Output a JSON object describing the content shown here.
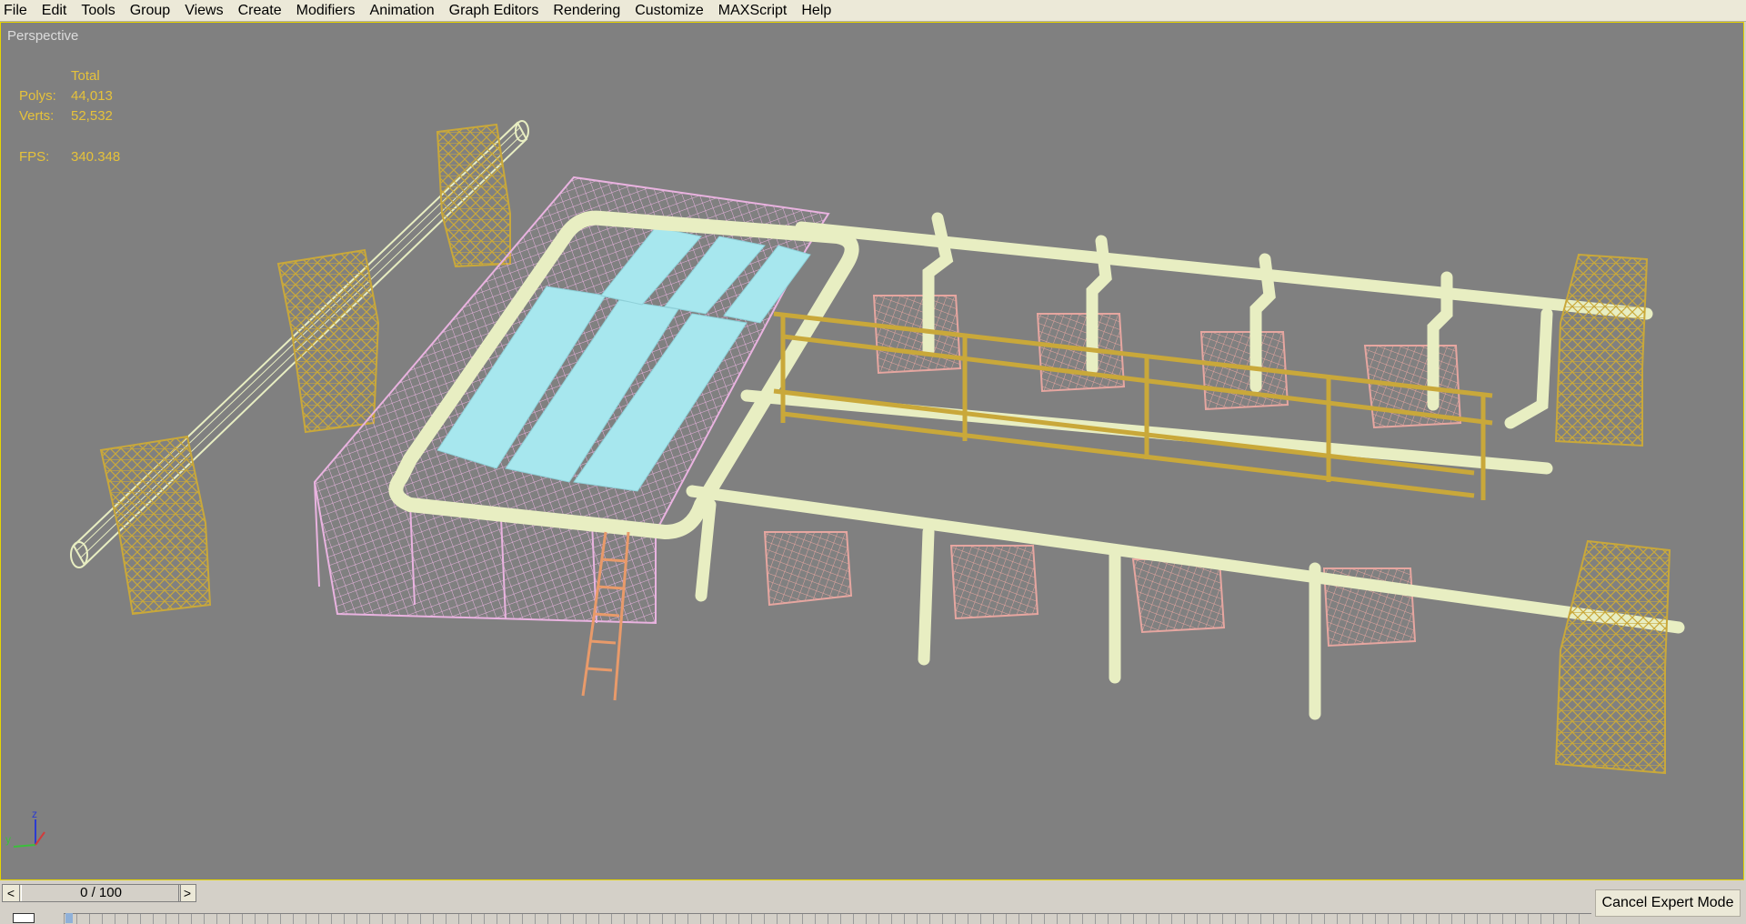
{
  "menu": [
    "File",
    "Edit",
    "Tools",
    "Group",
    "Views",
    "Create",
    "Modifiers",
    "Animation",
    "Graph Editors",
    "Rendering",
    "Customize",
    "MAXScript",
    "Help"
  ],
  "viewport": {
    "label": "Perspective",
    "stats": {
      "header": "Total",
      "polys_label": "Polys:",
      "polys_value": "44,013",
      "verts_label": "Verts:",
      "verts_value": "52,532",
      "fps_label": "FPS:",
      "fps_value": "340.348"
    },
    "axis": {
      "z": "z",
      "y": "y"
    },
    "scene_colors": {
      "background": "#808080",
      "steel_yellow": "#c9a83a",
      "pipe_cream": "#e8eec2",
      "frame_pink": "#e9b3e0",
      "equipment_salmon": "#e6a6a0",
      "glass_cyan": "#a7e7ee",
      "stairs_orange": "#e89a6a"
    }
  },
  "timeline": {
    "frame_display": "0 / 100",
    "prev_arrow": "<",
    "next_arrow": ">",
    "expert_button": "Cancel Expert Mode"
  }
}
